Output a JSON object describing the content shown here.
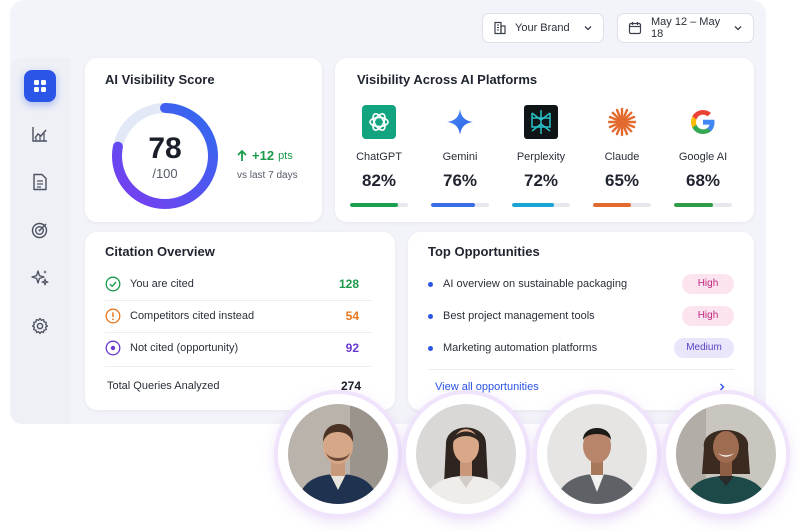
{
  "header": {
    "brand_label": "Your Brand",
    "date_label": "May 12 – May 18"
  },
  "sidebar": {
    "items": [
      {
        "icon": "grid-icon",
        "active": true
      },
      {
        "icon": "chart-icon",
        "active": false
      },
      {
        "icon": "document-icon",
        "active": false
      },
      {
        "icon": "target-icon",
        "active": false
      },
      {
        "icon": "sparkle-icon",
        "active": false
      },
      {
        "icon": "gear-icon",
        "active": false
      }
    ]
  },
  "score_card": {
    "title": "AI Visibility Score",
    "score": "78",
    "score_max": "/100",
    "score_fraction": 0.78,
    "delta_value": "+12",
    "delta_unit": "pts",
    "delta_note": "vs last 7 days"
  },
  "platforms_card": {
    "title": "Visibility Across AI Platforms",
    "platforms": [
      {
        "name": "ChatGPT",
        "value": "82%",
        "fraction": 0.82,
        "color": "#1aa04f",
        "icon": "chatgpt-logo-icon"
      },
      {
        "name": "Gemini",
        "value": "76%",
        "fraction": 0.76,
        "color": "#3a6ee8",
        "icon": "gemini-logo-icon"
      },
      {
        "name": "Perplexity",
        "value": "72%",
        "fraction": 0.72,
        "color": "#1aa5d6",
        "icon": "perplexity-logo-icon"
      },
      {
        "name": "Claude",
        "value": "65%",
        "fraction": 0.65,
        "color": "#e36a2e",
        "icon": "claude-logo-icon"
      },
      {
        "name": "Google AI",
        "value": "68%",
        "fraction": 0.68,
        "color": "#2e9d45",
        "icon": "google-logo-icon"
      }
    ]
  },
  "citation_card": {
    "title": "Citation Overview",
    "rows": [
      {
        "label": "You are cited",
        "value": "128",
        "color": "#1a9a4a",
        "icon": "check-circle-icon"
      },
      {
        "label": "Competitors cited instead",
        "value": "54",
        "color": "#e8761e",
        "icon": "alert-circle-icon"
      },
      {
        "label": "Not cited (opportunity)",
        "value": "92",
        "color": "#6a3ad0",
        "icon": "dot-circle-icon"
      }
    ],
    "total_label": "Total Queries Analyzed",
    "total_value": "274"
  },
  "opportunities_card": {
    "title": "Top Opportunities",
    "items": [
      {
        "label": "AI overview on sustainable packaging",
        "priority": "High"
      },
      {
        "label": "Best project management tools",
        "priority": "High"
      },
      {
        "label": "Marketing automation platforms",
        "priority": "Medium"
      }
    ],
    "view_all": "View all opportunities"
  },
  "avatars": [
    {
      "name": "avatar-man-blue-suit"
    },
    {
      "name": "avatar-woman-white-blazer"
    },
    {
      "name": "avatar-man-grey-suit"
    },
    {
      "name": "avatar-woman-green-blazer"
    }
  ]
}
